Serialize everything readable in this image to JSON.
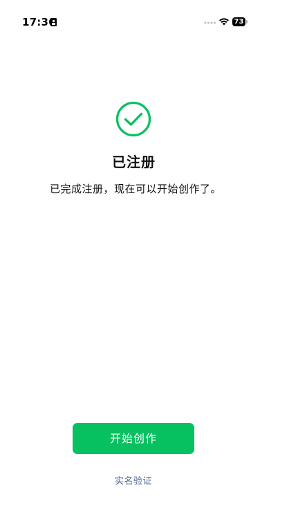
{
  "status_bar": {
    "time": "17:36",
    "battery_level": "73"
  },
  "icons": {
    "success": "check-circle-icon",
    "sim": "sim-card-icon",
    "wifi": "wifi-icon",
    "battery": "battery-icon"
  },
  "colors": {
    "accent": "#07c160",
    "link": "#576b95"
  },
  "content": {
    "title": "已注册",
    "message": "已完成注册，现在可以开始创作了。"
  },
  "actions": {
    "primary_label": "开始创作",
    "secondary_label": "实名验证"
  }
}
